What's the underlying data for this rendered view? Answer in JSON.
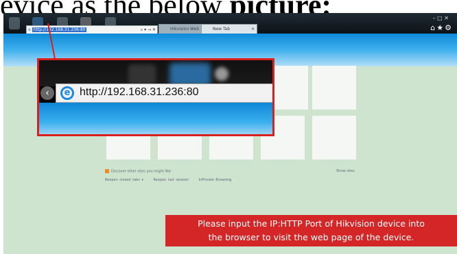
{
  "caption": {
    "normal": "evice as the below ",
    "bold": "picture:"
  },
  "browser": {
    "address_small": "http://192.168.31.236:80",
    "address_controls": "⌕ ▾ → ✕",
    "tabs": [
      {
        "label": "Hikvision Web Service"
      },
      {
        "label": "New Tab"
      }
    ],
    "window_controls": "– □ ✕",
    "toolbar_icons": "⌂★⚙"
  },
  "new_tab_page": {
    "discover_text": "Discover other sites you might like",
    "show_sites": "Show sites",
    "links": [
      "Reopen closed tabs ▾",
      "Reopen last session",
      "InPrivate Browsing"
    ]
  },
  "zoom_callout": {
    "url": "http://192.168.31.236:80"
  },
  "note": {
    "line1": "Please input the IP:HTTP Port of Hikvision device into",
    "line2": "the browser to visit the web page of the device."
  },
  "colors": {
    "accent_red": "#d42626",
    "ie_blue": "#1e88e5",
    "page_bg": "#cfe4cf"
  }
}
